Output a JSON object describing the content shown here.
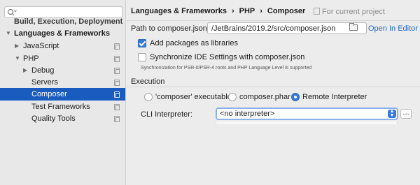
{
  "sidebar": {
    "search": {
      "value": ""
    },
    "cut_item": "Build, Execution, Deployment",
    "items": [
      {
        "label": "Languages & Frameworks",
        "arrow": "▼",
        "bold": true
      },
      {
        "label": "JavaScript",
        "arrow": "▶"
      },
      {
        "label": "PHP",
        "arrow": "▼"
      },
      {
        "label": "Debug",
        "arrow": "▶"
      },
      {
        "label": "Servers"
      },
      {
        "label": "Composer",
        "selected": true
      },
      {
        "label": "Test Frameworks"
      },
      {
        "label": "Quality Tools"
      }
    ]
  },
  "header": {
    "breadcrumb": [
      "Languages & Frameworks",
      "PHP",
      "Composer"
    ],
    "separator": "›",
    "scope": "For current project"
  },
  "path": {
    "label": "Path to composer.json:",
    "value": "/JetBrains/2019.2/src/composer.json",
    "open_link": "Open In Editor"
  },
  "options": {
    "add_packages": {
      "label": "Add packages as libraries",
      "checked": true
    },
    "sync_ide": {
      "label": "Synchronize IDE Settings with composer.json",
      "checked": false
    },
    "hint": "Synchronization for PSR-0/PSR-4 roots and PHP Language Level is supported"
  },
  "execution": {
    "title": "Execution",
    "radios": [
      {
        "label": "'composer' executable",
        "checked": false
      },
      {
        "label": "composer.phar",
        "checked": false
      },
      {
        "label": "Remote Interpreter",
        "checked": true
      }
    ],
    "cli_label": "CLI Interpreter:",
    "cli_value": "<no interpreter>",
    "more_label": "..."
  },
  "colors": {
    "selection": "#1a5bbf",
    "accent": "#3679d9",
    "link": "#2368c4"
  }
}
